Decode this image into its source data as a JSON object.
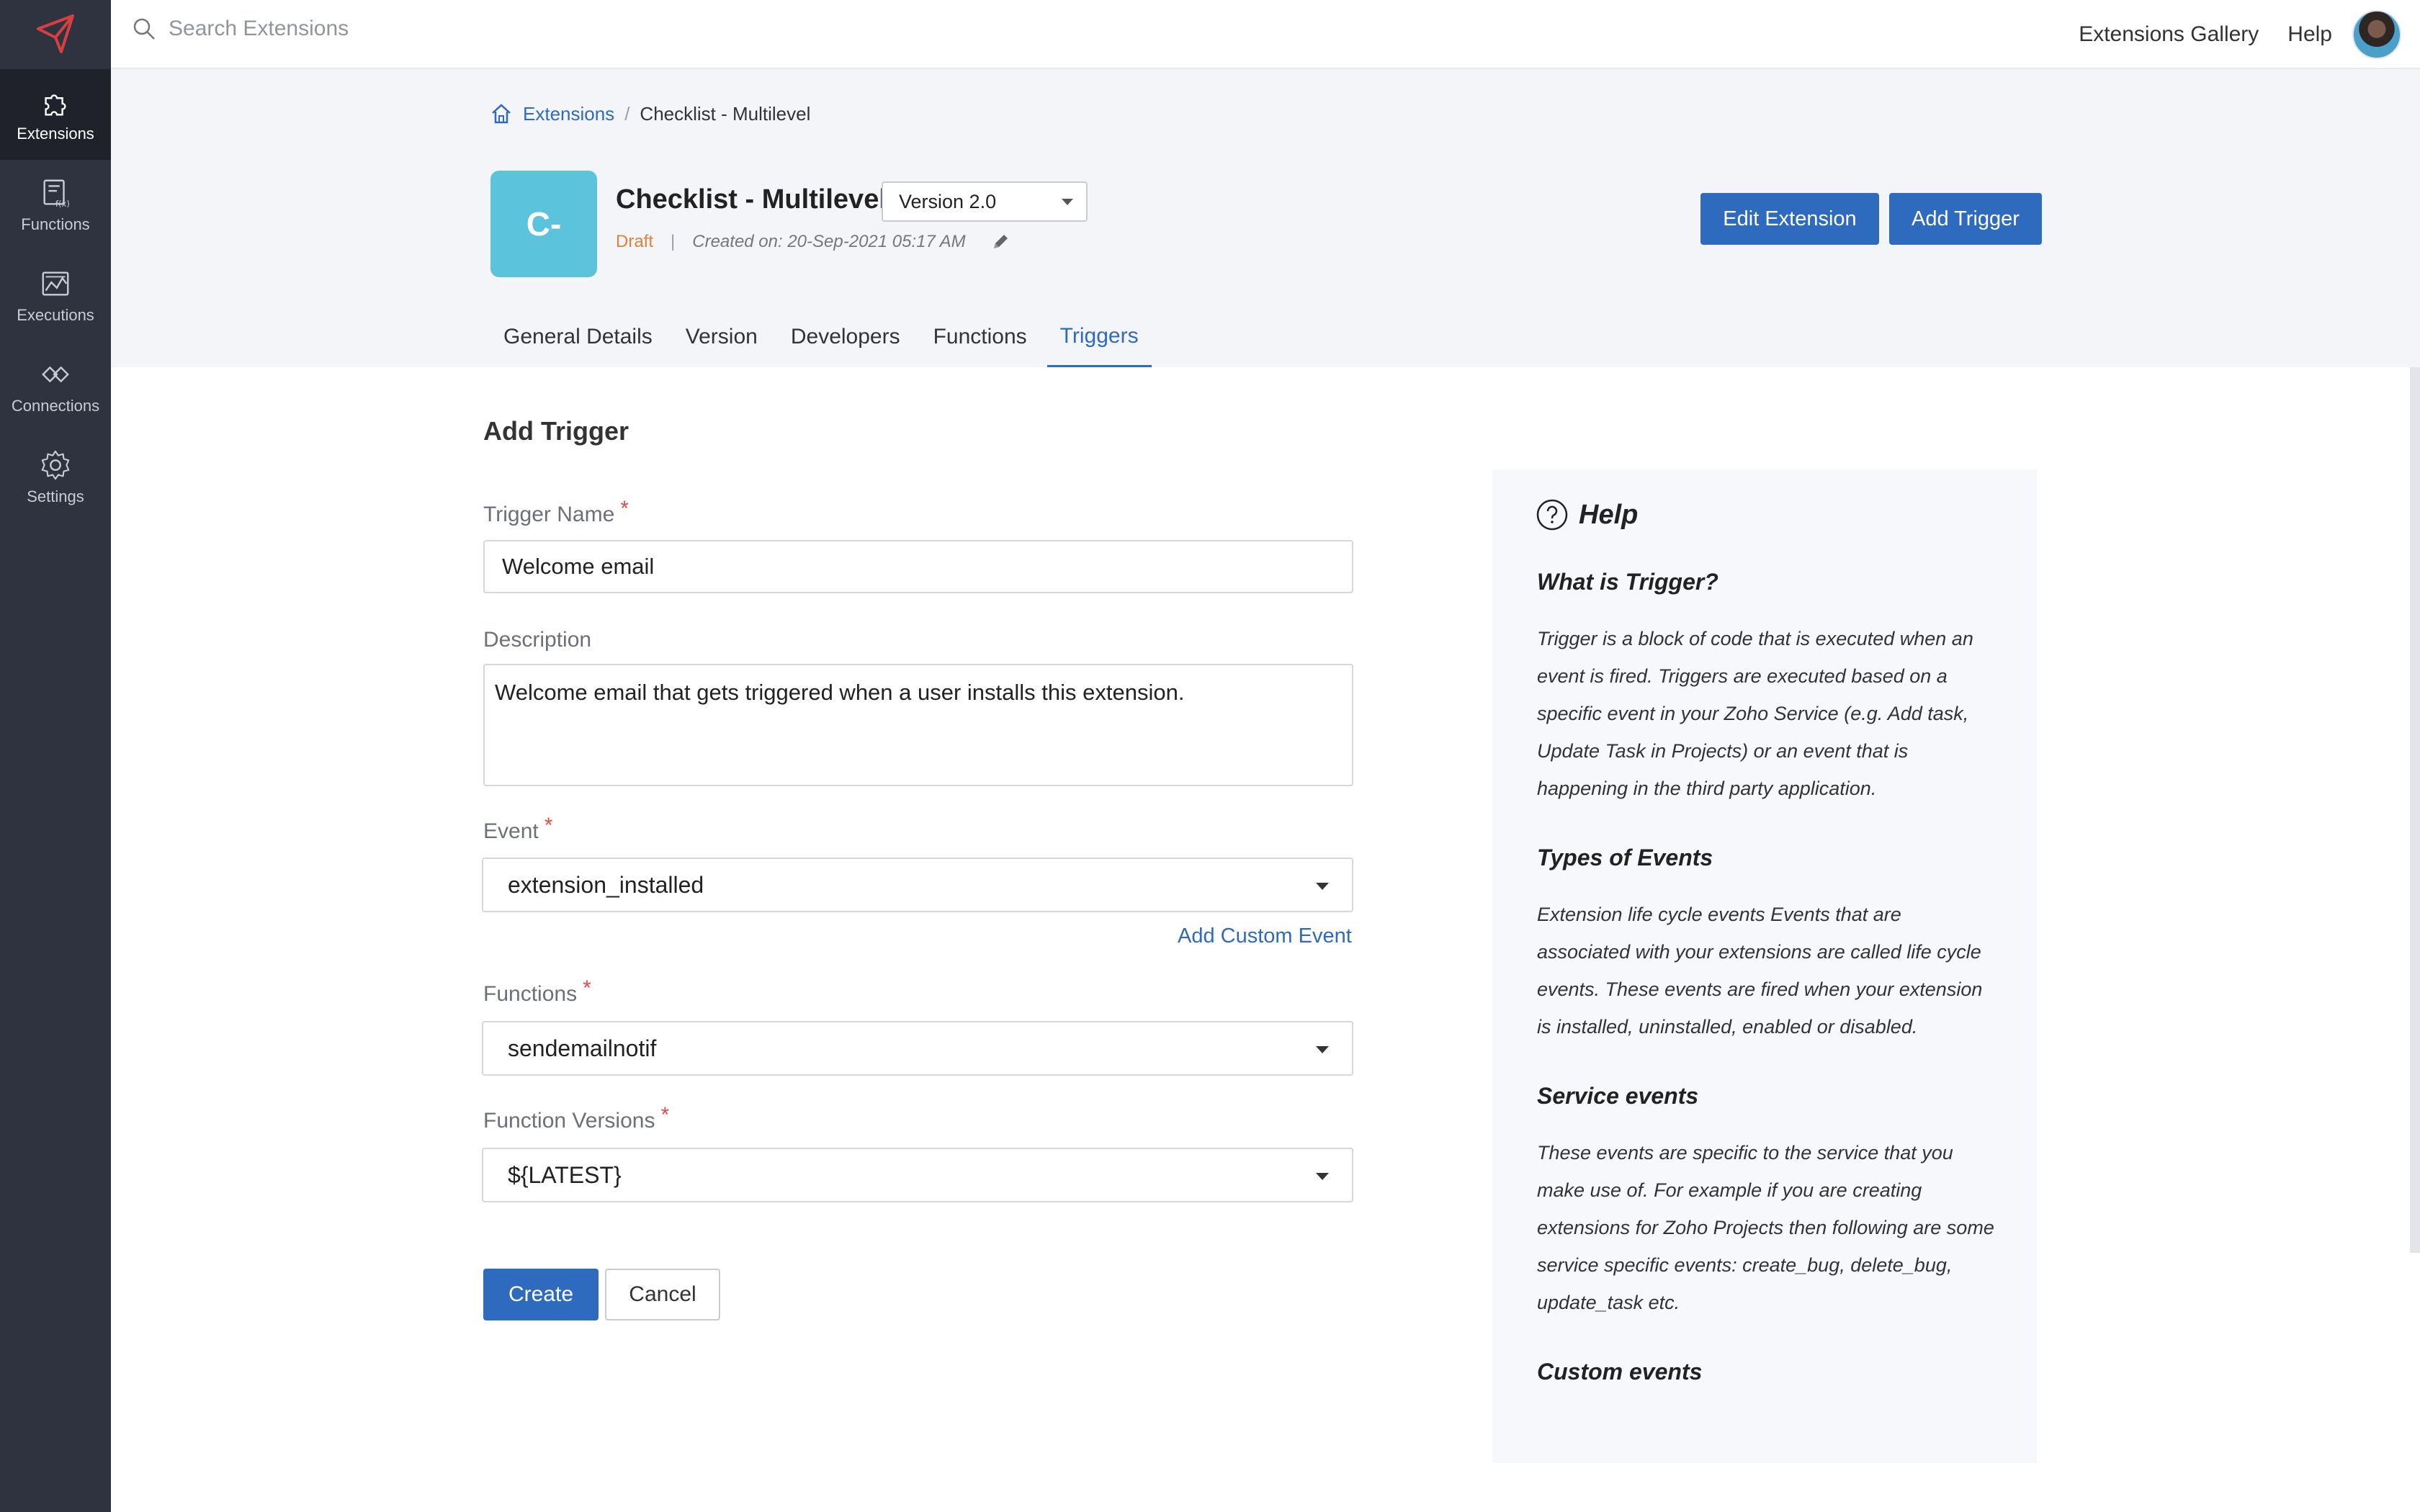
{
  "sidebar": {
    "items": [
      {
        "label": "Extensions"
      },
      {
        "label": "Functions"
      },
      {
        "label": "Executions"
      },
      {
        "label": "Connections"
      },
      {
        "label": "Settings"
      }
    ]
  },
  "topbar": {
    "search_placeholder": "Search Extensions",
    "gallery": "Extensions Gallery",
    "help": "Help"
  },
  "breadcrumb": {
    "root": "Extensions",
    "separator": "/",
    "current": "Checklist - Multilevel"
  },
  "extension": {
    "icon_text": "C-",
    "title": "Checklist - Multilevel",
    "version": "Version 2.0",
    "status": "Draft",
    "separator": "|",
    "created": "Created on: 20-Sep-2021 05:17 AM"
  },
  "actions": {
    "edit": "Edit Extension",
    "add_trigger": "Add Trigger"
  },
  "tabs": [
    {
      "label": "General Details"
    },
    {
      "label": "Version"
    },
    {
      "label": "Developers"
    },
    {
      "label": "Functions"
    },
    {
      "label": "Triggers"
    }
  ],
  "form": {
    "title": "Add Trigger",
    "required_mark": "*",
    "trigger_name": {
      "label": "Trigger Name",
      "value": "Welcome email"
    },
    "description": {
      "label": "Description",
      "value": "Welcome email that gets triggered when a user installs this extension."
    },
    "event": {
      "label": "Event",
      "value": "extension_installed"
    },
    "add_custom_event": "Add Custom Event",
    "functions": {
      "label": "Functions",
      "value": "sendemailnotif"
    },
    "function_versions": {
      "label": "Function Versions",
      "value": "${LATEST}"
    },
    "create": "Create",
    "cancel": "Cancel"
  },
  "help": {
    "title": "Help",
    "sections": [
      {
        "heading": "What is Trigger?",
        "body": "Trigger is a block of code that is executed when an event is fired. Triggers are executed based on a specific event in your Zoho Service (e.g. Add task, Update Task in Projects) or an event that is happening in the third party application."
      },
      {
        "heading": "Types of Events",
        "body": "Extension life cycle events Events that are associated with your extensions are called life cycle events. These events are fired when your extension is installed, uninstalled, enabled or disabled."
      },
      {
        "heading": "Service events",
        "body": "These events are specific to the service that you make use of. For example if you are creating extensions for Zoho Projects then following are some service specific events: create_bug, delete_bug, update_task etc."
      },
      {
        "heading": "Custom events",
        "body": ""
      }
    ]
  },
  "colors": {
    "sidebar": "#2f3340",
    "accent": "#2e6bbf",
    "draft": "#e2813a",
    "ext_icon": "#5bc3dc"
  }
}
